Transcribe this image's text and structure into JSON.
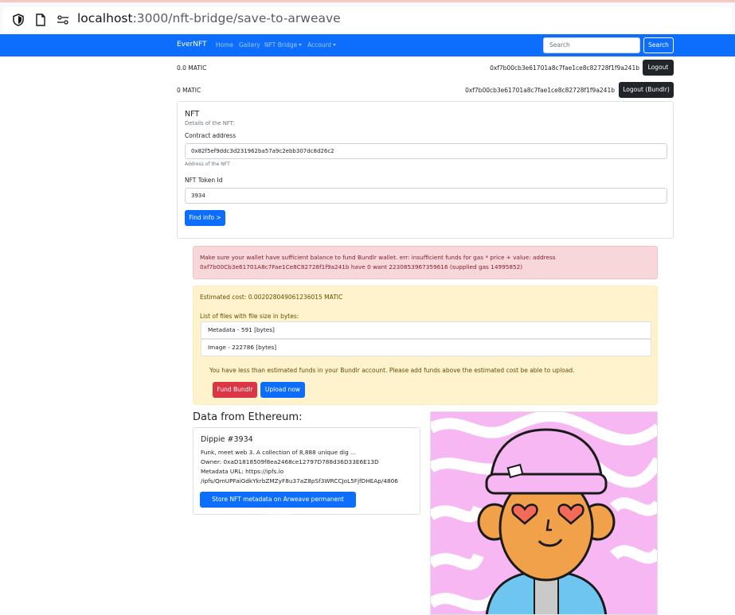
{
  "browser": {
    "url_host": "localhost",
    "url_rest": ":3000/nft-bridge/save-to-arweave"
  },
  "navbar": {
    "brand": "EverNFT",
    "links": [
      "Home",
      "Gallery",
      "NFT Bridge",
      "Account"
    ],
    "search_placeholder": "Search",
    "search_button": "Search"
  },
  "wallet": {
    "matic_balance": "0.0 MATIC",
    "address": "0xf7b00cb3e61701a8c7fae1ce8c82728f1f9a241b",
    "logout": "Logout",
    "bundlr_balance": "0 MATIC",
    "bundlr_address": "0xf7b00cb3e61701a8c7fae1ce8c82728f1f9a241b",
    "logout_bundlr": "Logout (Bundlr)"
  },
  "nft_form": {
    "title": "NFT",
    "subtitle": "Details of the NFT:",
    "contract_label": "Contract address",
    "contract_value": "0x82f5ef9ddc3d231962ba57a9c2ebb307dc8d26c2",
    "contract_help": "Address of the NFT",
    "token_label": "NFT Token Id",
    "token_value": "3934",
    "find_button": "Find info >"
  },
  "error_alert": {
    "line1": "Make sure your wallet have sufficient balance to fund Bundlr wallet. err: insufficient funds for gas * price + value: address",
    "line2": "0xf7b00Cb3e61701A8c7Fae1Ce8C82728f1f9a241b have 0 want 2230853967359616 (supplied gas 14995852)"
  },
  "cost_alert": {
    "estimated": "Estimated cost: 0.002028049061236015 MATIC",
    "files_label": "List of files with file size in bytes:",
    "files": [
      "Metadata - 591 [bytes]",
      "Image - 222786 [bytes]"
    ],
    "warning": "You have less than estimated funds in your Bundlr account. Please add funds above the estimated cost be able to upload.",
    "fund_button": "Fund Bundlr",
    "upload_button": "Upload now"
  },
  "ethereum": {
    "heading": "Data from Ethereum:",
    "name": "Dippie #3934",
    "description": "Funk, meet web 3. A collection of 8,888 unique dig ...",
    "owner": "Owner: 0xaD1818509f8ea2468ce12797D788d36D33E6E13D",
    "metadata_url_1": "Metadata URL: https://ipfs.io",
    "metadata_url_2": "/ipfs/QmUPFaiGdkYkrbZMZyF8u37aZ8pSf3WRCCJoL5FjfDHEAp/4806",
    "store_button": "Store NFT metadata on Arweave permanent storage"
  },
  "colors": {
    "primary": "#0d6efd",
    "danger": "#dc3545",
    "dark": "#212529",
    "warning_bg": "#fff3cd",
    "danger_bg": "#f8d7da"
  },
  "icons": [
    "shield-icon",
    "page-icon",
    "permissions-icon"
  ]
}
